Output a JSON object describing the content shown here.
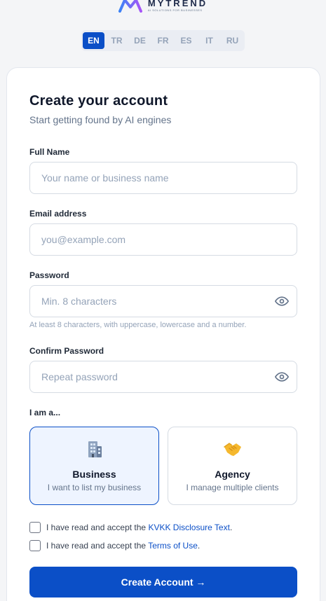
{
  "brand": {
    "name": "MYTREND",
    "tagline": "AI SOLUTIONS FOR BUSINESSES",
    "colors": {
      "primary": "#0b4fc7",
      "logo_left": "#3b82f6",
      "logo_right": "#a855f7"
    }
  },
  "languages": {
    "items": [
      "EN",
      "TR",
      "DE",
      "FR",
      "ES",
      "IT",
      "RU"
    ],
    "selected": "EN"
  },
  "form": {
    "title": "Create your account",
    "subtitle": "Start getting found by AI engines",
    "full_name": {
      "label": "Full Name",
      "placeholder": "Your name or business name"
    },
    "email": {
      "label": "Email address",
      "placeholder": "you@example.com"
    },
    "password": {
      "label": "Password",
      "placeholder": "Min. 8 characters",
      "hint": "At least 8 characters, with uppercase, lowercase and a number.",
      "icon": "eye-icon"
    },
    "confirm_password": {
      "label": "Confirm Password",
      "placeholder": "Repeat password",
      "icon": "eye-icon"
    },
    "role": {
      "label": "I am a...",
      "options": [
        {
          "title": "Business",
          "description": "I want to list my business",
          "icon": "building-icon",
          "selected": true
        },
        {
          "title": "Agency",
          "description": "I manage multiple clients",
          "icon": "handshake-icon",
          "selected": false
        }
      ]
    },
    "consents": [
      {
        "prefix": "I have read and accept the",
        "link": "KVKK Disclosure Text",
        "suffix": "."
      },
      {
        "prefix": "I have read and accept the",
        "link": "Terms of Use",
        "suffix": "."
      }
    ],
    "submit_label": "Create Account →"
  }
}
